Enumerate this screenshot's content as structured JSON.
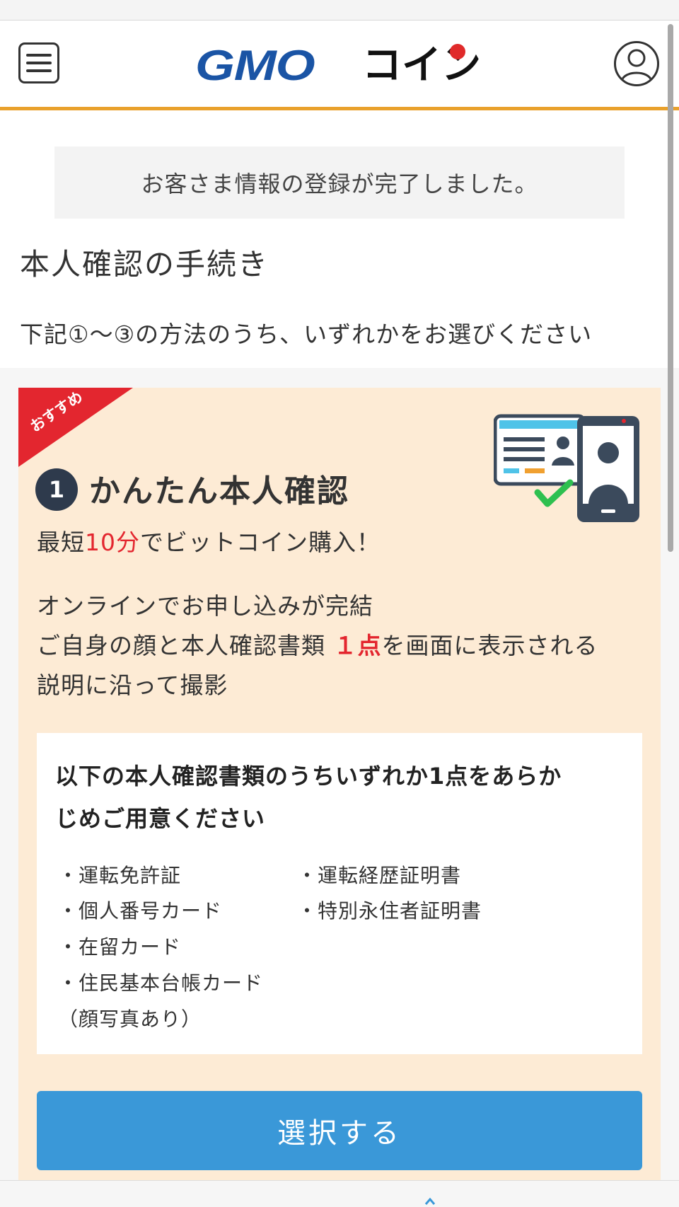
{
  "header": {
    "menu_icon": "hamburger-menu-icon",
    "logo_gmo": "GMO",
    "logo_coin": "コイン",
    "account_icon": "user-account-icon",
    "rule_color": "#e9a12c"
  },
  "notice": {
    "text": "お客さま情報の登録が完了しました。"
  },
  "main": {
    "title": "本人確認の手続き",
    "instruction": "下記①〜③の方法のうち、いずれかをお選びください"
  },
  "option": {
    "ribbon_label": "おすすめ",
    "ribbon_color": "#e3262f",
    "step_number": "1",
    "title": "かんたん本人確認",
    "illustration_icon": "id-card-smartphone-verification-icon",
    "promo": {
      "before": "最短",
      "highlight": "10分",
      "after": "でビットコイン購入！"
    },
    "description": {
      "line1": "オンラインでお申し込みが完結",
      "line2_before": "ご自身の顔と本人確認書類",
      "line2_highlight": "１点",
      "line2_after": "を画面に表示される",
      "line3": "説明に沿って撮影"
    },
    "documents": {
      "heading_line1": "以下の本人確認書類のうちいずれか1点をあらか",
      "heading_line2": "じめご用意ください",
      "left_items": [
        "・運転免許証",
        "・個人番号カード",
        "・在留カード",
        "・住民基本台帳カード",
        "（顔写真あり）"
      ],
      "right_items": [
        "・運転経歴証明書",
        "・特別永住者証明書"
      ]
    },
    "button_label": "選択する",
    "button_color": "#3a98d8"
  }
}
